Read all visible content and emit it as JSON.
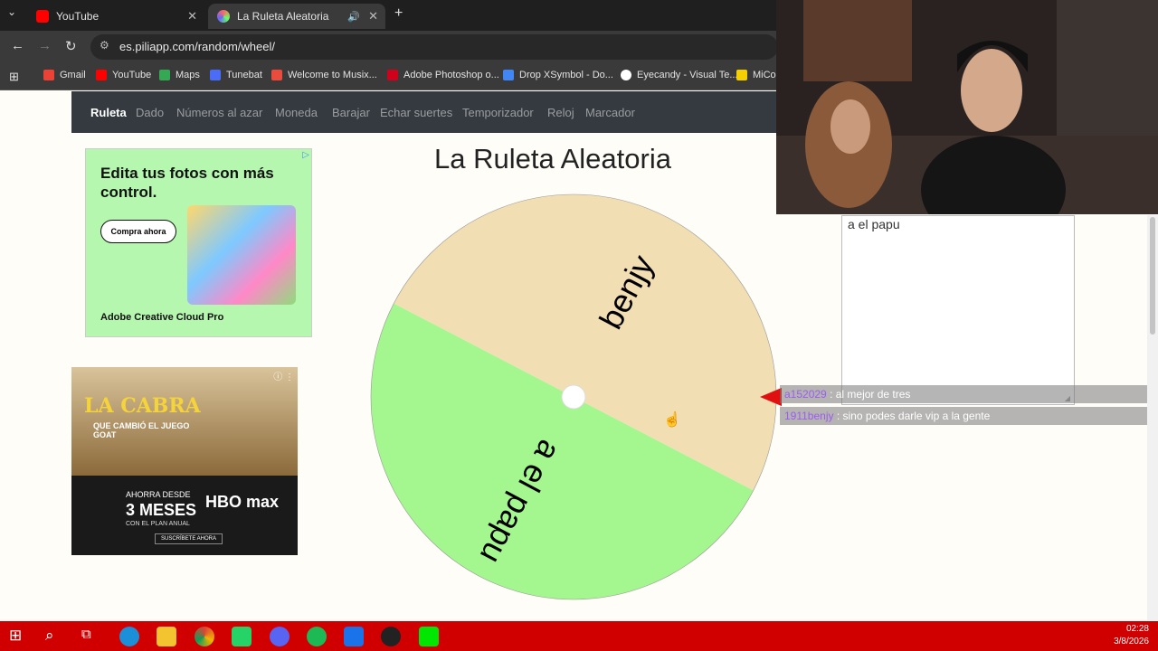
{
  "browser": {
    "tabs": [
      {
        "label": "YouTube",
        "active": false
      },
      {
        "label": "La Ruleta Aleatoria",
        "active": true
      }
    ],
    "url": "es.piliapp.com/random/wheel/",
    "bookmarks": [
      "Gmail",
      "YouTube",
      "Maps",
      "Tunebat",
      "Welcome to Musix...",
      "Adobe Photoshop o...",
      "Drop XSymbol - Do...",
      "Eyecandy - Visual Te...",
      "MiCo"
    ]
  },
  "site_nav": {
    "items": [
      "Ruleta",
      "Dado",
      "Números al azar",
      "Moneda",
      "Barajar",
      "Echar suertes",
      "Temporizador",
      "Reloj",
      "Marcador"
    ],
    "active": "Ruleta"
  },
  "ads": {
    "adobe": {
      "headline": "Edita tus fotos con más control.",
      "button": "Compra ahora",
      "brand": "Adobe Creative Cloud Pro"
    },
    "hbo": {
      "title": "LA CABRA",
      "subtitle": "QUE CAMBIÓ EL JUEGO GOAT",
      "promo_top": "AHORRA DESDE",
      "promo_main": "3 MESES",
      "promo_bottom": "CON EL PLAN ANUAL",
      "logo": "HBO max",
      "cta": "SUSCRÍBETE AHORA"
    }
  },
  "page_title": "La Ruleta Aleatoria",
  "wheel": {
    "segments": [
      {
        "label": "benjy",
        "color": "#a4f68f",
        "share": 0.5
      },
      {
        "label": "a el papu",
        "color": "#f2deb3",
        "share": 0.5
      }
    ],
    "pointer_color": "#e01010"
  },
  "entries_box": {
    "text": "a el papu"
  },
  "chat": [
    {
      "user": "a152029",
      "message": ": al mejor de tres"
    },
    {
      "user": "1911benjy",
      "message": ": sino podes darle vip a la gente"
    }
  ],
  "taskbar": {
    "time": "02:28",
    "date": "3/8/2026"
  }
}
